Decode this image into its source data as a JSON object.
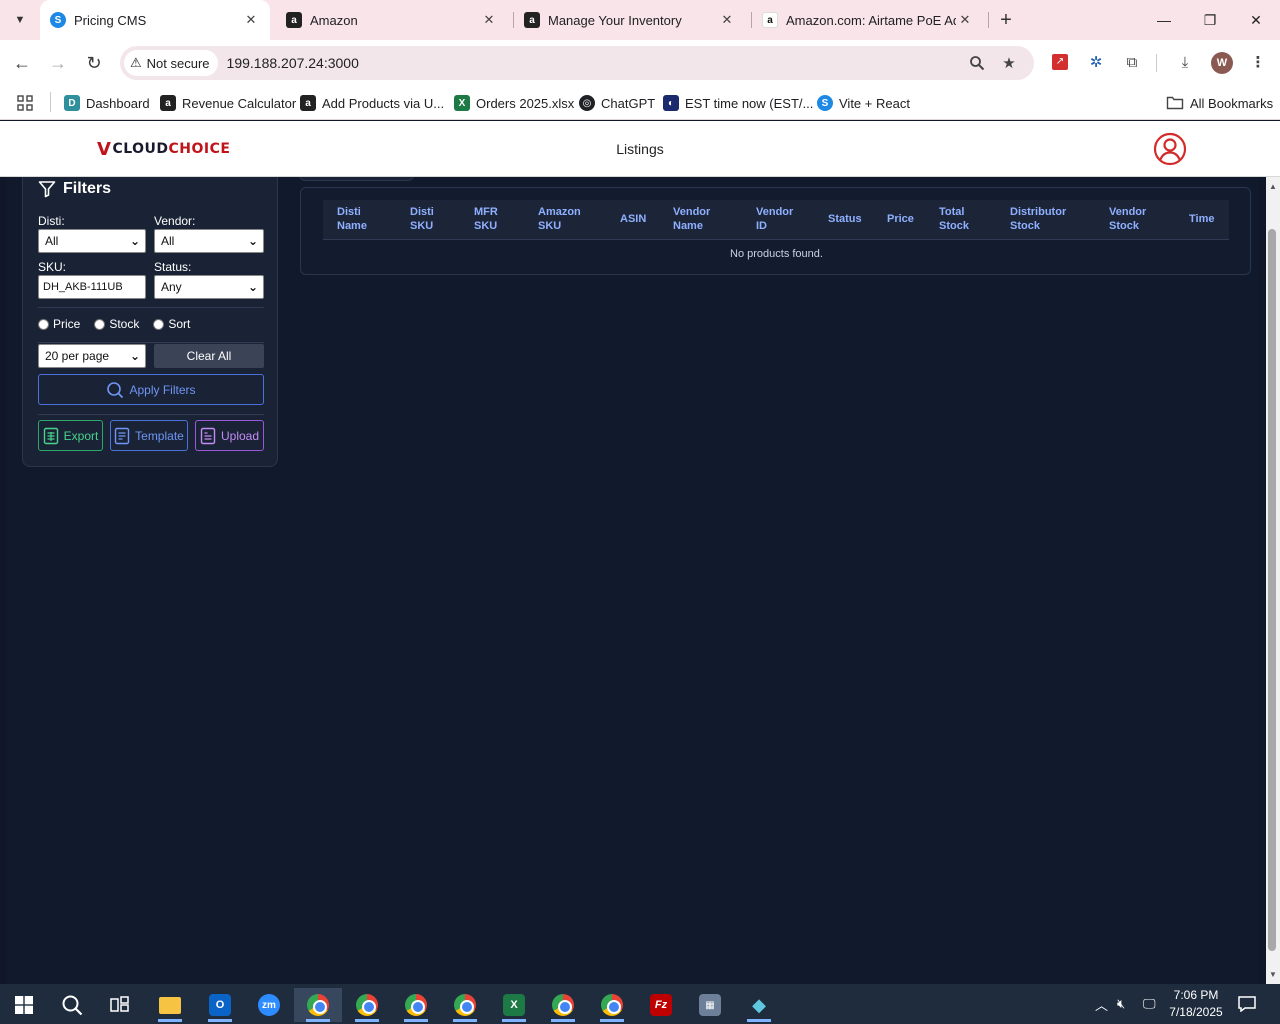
{
  "browser": {
    "tabs": [
      {
        "title": "Pricing CMS",
        "favicon": "S",
        "favicon_color": "#1e88e5",
        "active": true
      },
      {
        "title": "Amazon",
        "favicon": "a",
        "favicon_color": "#222222",
        "active": false
      },
      {
        "title": "Manage Your Inventory",
        "favicon": "a",
        "favicon_color": "#222222",
        "active": false
      },
      {
        "title": "Amazon.com: Airtame PoE Ada",
        "favicon": "a",
        "favicon_color": "#ffffff",
        "active": false
      }
    ],
    "security_label": "Not secure",
    "url": "199.188.207.24:3000",
    "profile_initial": "W",
    "bookmarks": [
      {
        "label": "Dashboard",
        "icon": "D",
        "color": "#2f8f9d"
      },
      {
        "label": "Revenue Calculator",
        "icon": "a",
        "color": "#222222"
      },
      {
        "label": "Add Products via U...",
        "icon": "a",
        "color": "#222222"
      },
      {
        "label": "Orders 2025.xlsx",
        "icon": "X",
        "color": "#1d7a45"
      },
      {
        "label": "ChatGPT",
        "icon": "◎",
        "color": "#202124"
      },
      {
        "label": "EST time now (EST/...",
        "icon": "◐",
        "color": "#1a2a6c"
      },
      {
        "label": "Vite + React",
        "icon": "S",
        "color": "#1e88e5"
      }
    ],
    "all_bookmarks": "All Bookmarks"
  },
  "app": {
    "logo_v": "V",
    "logo_cloud": "CLOUD",
    "logo_choice": "CHOICE",
    "header_title": "Listings"
  },
  "filters": {
    "title": "Filters",
    "disti_label": "Disti:",
    "disti_value": "All",
    "vendor_label": "Vendor:",
    "vendor_value": "All",
    "sku_label": "SKU:",
    "sku_value": "DH_AKB-111UB",
    "status_label": "Status:",
    "status_value": "Any",
    "radios": [
      "Price",
      "Stock",
      "Sort"
    ],
    "per_page_value": "20 per page",
    "clear_label": "Clear All",
    "apply_label": "Apply Filters",
    "export_label": "Export",
    "template_label": "Template",
    "upload_label": "Upload"
  },
  "table": {
    "headers": [
      [
        "Disti",
        "Name"
      ],
      [
        "Disti",
        "SKU"
      ],
      [
        "MFR",
        "SKU"
      ],
      [
        "Amazon",
        "SKU"
      ],
      [
        "ASIN"
      ],
      [
        "Vendor",
        "Name"
      ],
      [
        "Vendor",
        "ID"
      ],
      [
        "Status"
      ],
      [
        "Price"
      ],
      [
        "Total",
        "Stock"
      ],
      [
        "Distributor",
        "Stock"
      ],
      [
        "Vendor",
        "Stock"
      ],
      [
        "Time"
      ]
    ],
    "empty_message": "No products found."
  },
  "taskbar": {
    "time": "7:06 PM",
    "date": "7/18/2025"
  },
  "colors": {
    "page_bg": "#111a2c",
    "accent_blue": "#6f95f5",
    "export_green": "#47d38d",
    "upload_purple": "#c28cf5",
    "brand_red": "#c0141a"
  }
}
